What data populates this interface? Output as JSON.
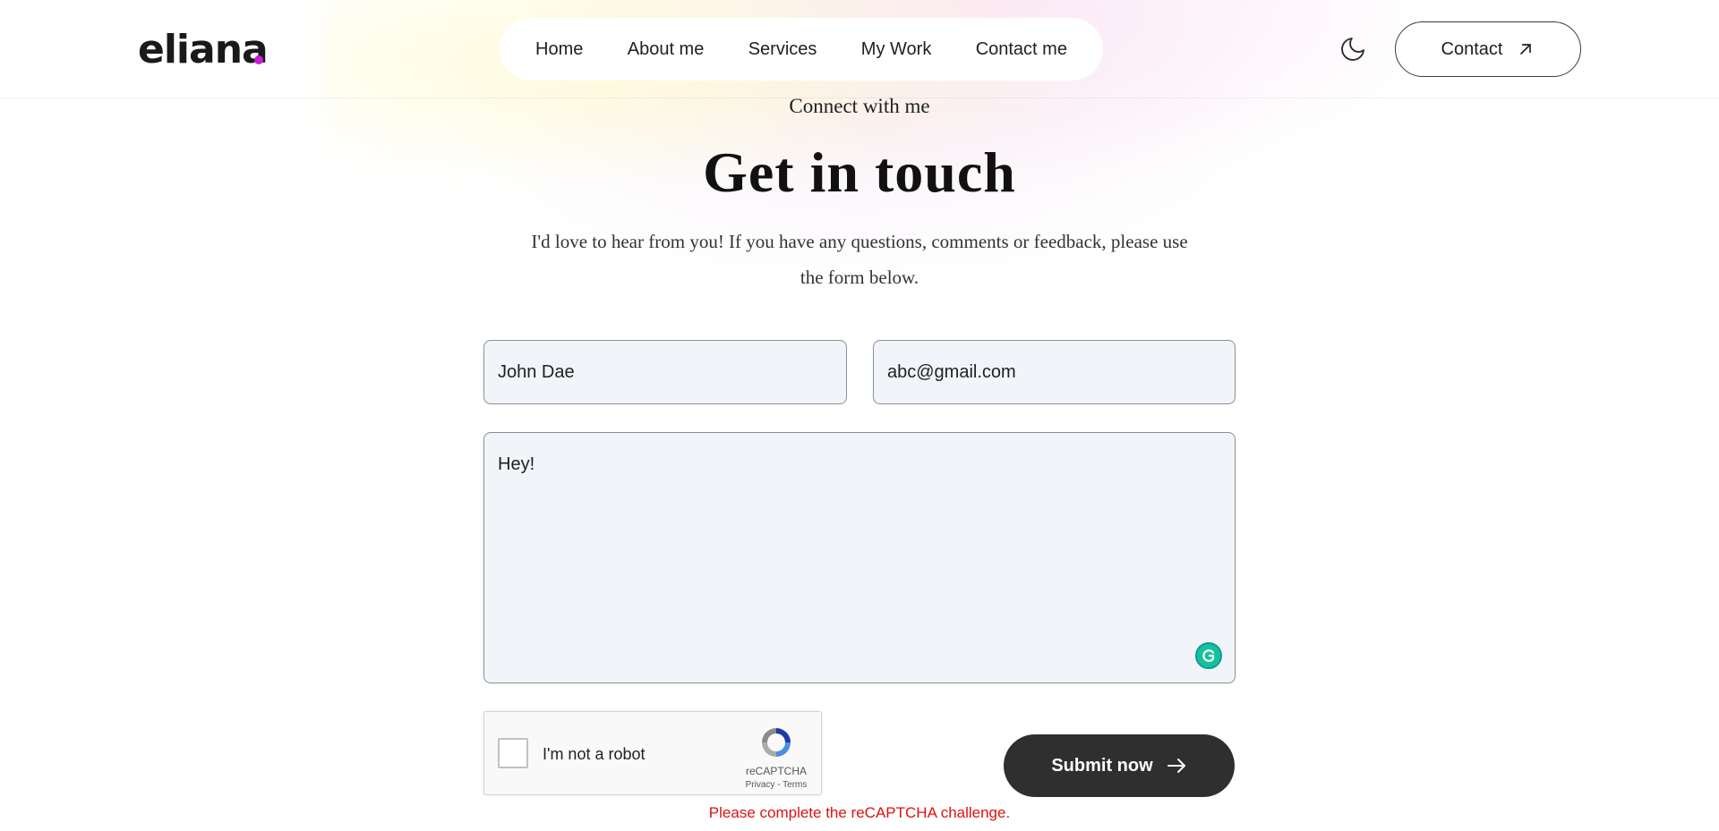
{
  "header": {
    "logo_text": "eliana",
    "nav": [
      "Home",
      "About me",
      "Services",
      "My Work",
      "Contact me"
    ],
    "contact_label": "Contact",
    "theme_icon": "moon-icon",
    "contact_icon": "arrow-up-right-icon"
  },
  "hero": {
    "eyebrow": "Connect with me",
    "title": "Get in touch",
    "subtitle": "I'd love to hear from you! If you have any questions, comments or feedback, please use the form below."
  },
  "form": {
    "name_value": "John Dae",
    "email_value": "abc@gmail.com",
    "message_value": "Hey!",
    "captcha_label": "I'm not a robot",
    "captcha_brand": "reCAPTCHA",
    "captcha_links": "Privacy - Terms",
    "submit_label": "Submit now",
    "submit_icon": "arrow-right-icon",
    "error": "Please complete the reCAPTCHA challenge."
  },
  "colors": {
    "accent_dot": "#c71ed8",
    "submit_bg": "#2f2f2f",
    "error": "#e01010",
    "field_bg": "#f1f4f8"
  }
}
